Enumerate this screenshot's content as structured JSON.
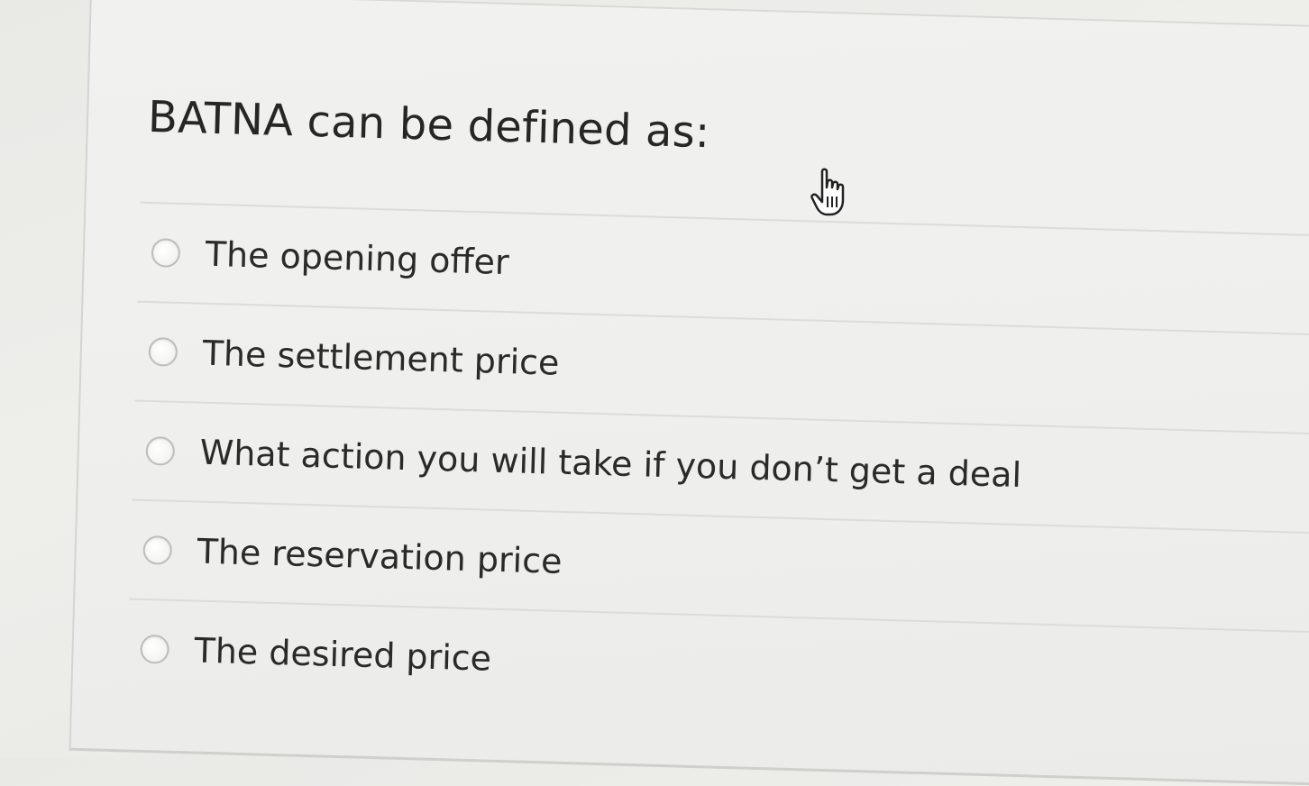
{
  "question": {
    "text": "BATNA can be defined as:"
  },
  "options": [
    {
      "label": "The opening offer",
      "selected": false
    },
    {
      "label": "The settlement price",
      "selected": false
    },
    {
      "label": "What action you will take if you don’t get a deal",
      "selected": false
    },
    {
      "label": "The reservation price",
      "selected": false
    },
    {
      "label": "The desired price",
      "selected": false
    }
  ],
  "cursor": {
    "icon": "hand-pointer-icon"
  }
}
